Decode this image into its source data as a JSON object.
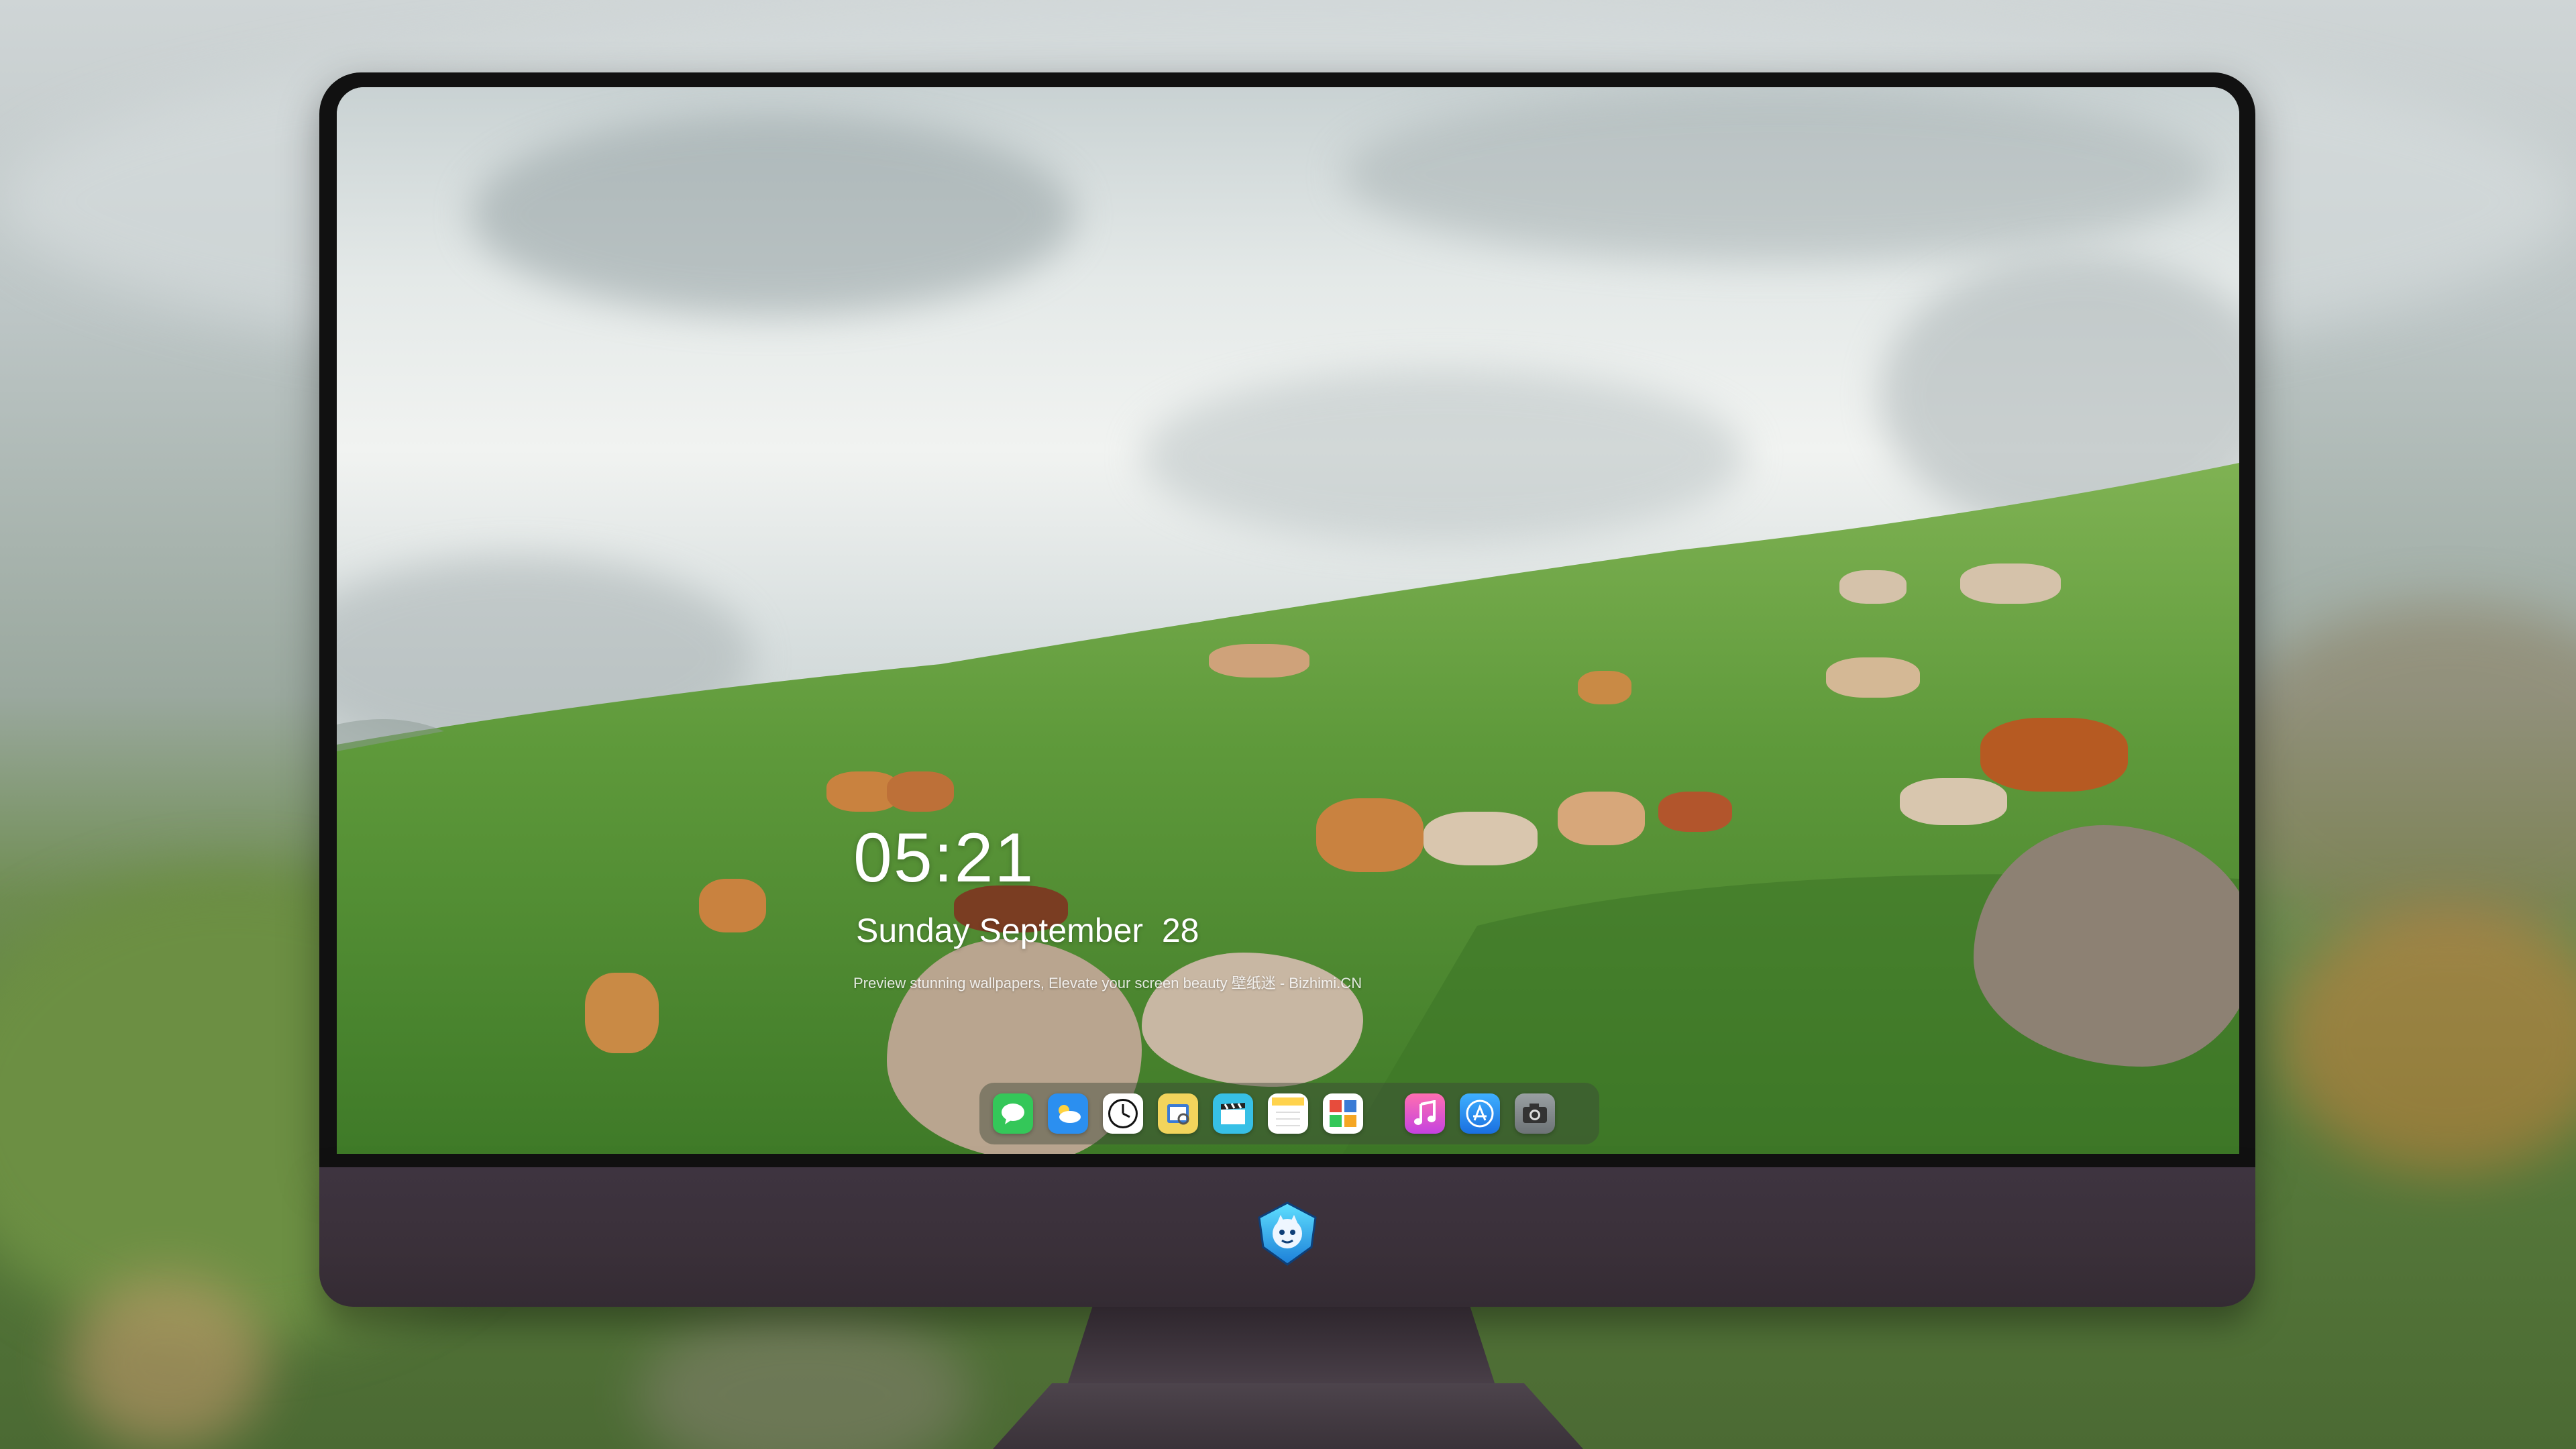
{
  "lockscreen": {
    "time": "05:21",
    "date": "Sunday September  28",
    "tagline": "Preview stunning wallpapers, Elevate your screen beauty  壁纸迷 - Bizhimi.CN"
  },
  "dock": {
    "apps": [
      {
        "name": "Messages",
        "icon": "messages-icon",
        "color": "#34c759"
      },
      {
        "name": "Weather",
        "icon": "weather-icon",
        "color": "#2b8ff0"
      },
      {
        "name": "Clock",
        "icon": "clock-icon",
        "color": "#ffffff"
      },
      {
        "name": "Preview",
        "icon": "preview-icon",
        "color": "#f2d45c"
      },
      {
        "name": "Final Cut",
        "icon": "clapperboard-icon",
        "color": "#37c0e6"
      },
      {
        "name": "Notes",
        "icon": "notes-icon",
        "color": "#ffd34d"
      },
      {
        "name": "Photo Booth",
        "icon": "photo-booth-icon",
        "color": "#e74c3c"
      },
      {
        "name": "Music",
        "icon": "music-icon",
        "color": "#ff4fa0"
      },
      {
        "name": "App Store",
        "icon": "app-store-icon",
        "color": "#1a8cff"
      },
      {
        "name": "Camera",
        "icon": "camera-icon",
        "color": "#7f8588"
      }
    ]
  },
  "monitor": {
    "logo": "shield-mascot-logo",
    "bezel_color": "#111111",
    "chin_color": "#3b3139"
  }
}
